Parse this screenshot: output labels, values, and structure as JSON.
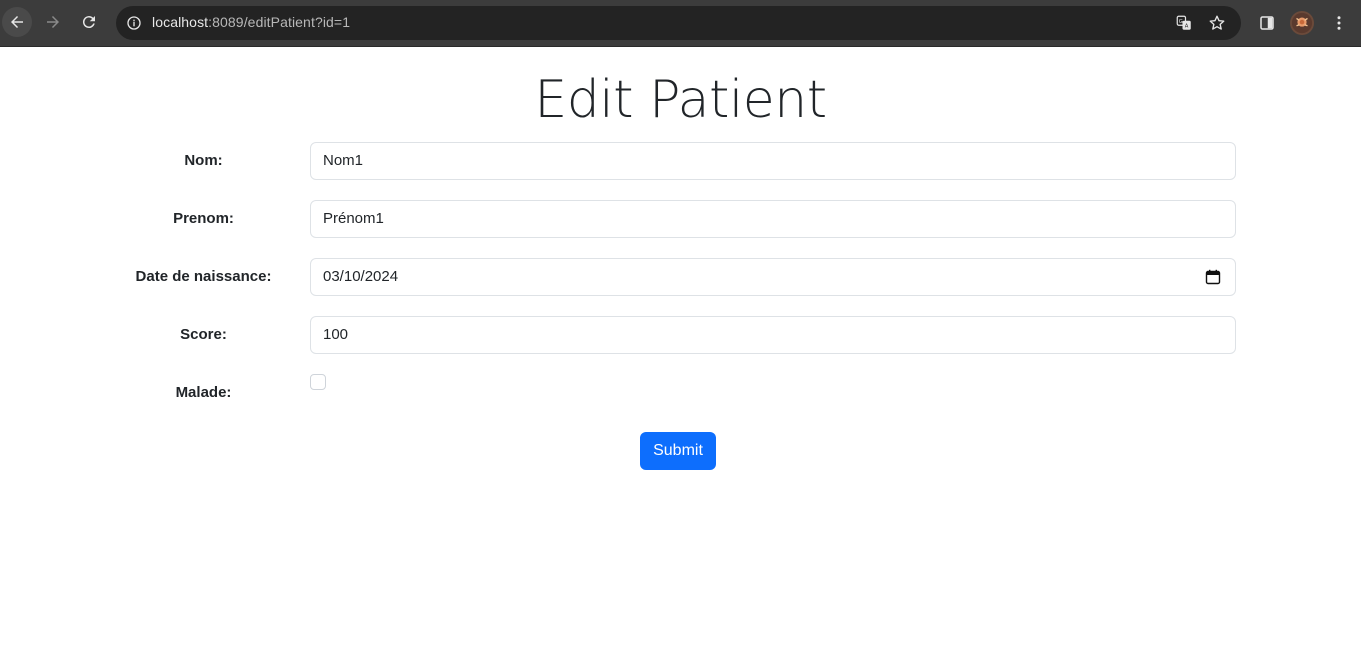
{
  "browser": {
    "url_host": "localhost",
    "url_rest": ":8089/editPatient?id=1"
  },
  "page": {
    "title": "Edit Patient"
  },
  "form": {
    "nom": {
      "label": "Nom:",
      "value": "Nom1"
    },
    "prenom": {
      "label": "Prenom:",
      "value": "Prénom1"
    },
    "date_naissance": {
      "label": "Date de naissance:",
      "value": "03/10/2024"
    },
    "score": {
      "label": "Score:",
      "value": "100"
    },
    "malade": {
      "label": "Malade:",
      "checked": false
    },
    "submit_label": "Submit"
  },
  "colors": {
    "primary": "#0d6efd",
    "toolbar": "#3c3c3c",
    "omnibox": "#232323"
  }
}
